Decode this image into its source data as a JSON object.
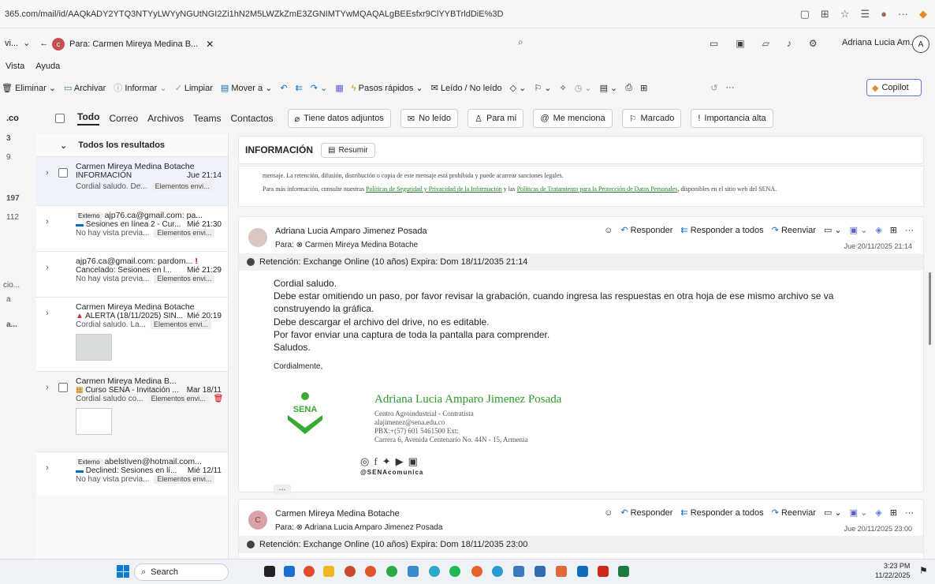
{
  "browser": {
    "url": "365.com/mail/id/AAQkADY2YTQ3NTYyLWYyNGUtNGI2Zi1hN2M5LWZkZmE3ZGNIMTYwMQAQALgBEEsfxr9ClYYBTrldDiE%3D"
  },
  "titlebar": {
    "tab_label": "Para: Carmen Mireya Medina B...",
    "tab_avatar": "c",
    "view_label": "vi...",
    "account_name": "Adriana Lucia Am...",
    "account_initial": "A"
  },
  "menu": {
    "items": [
      "Vista",
      "Ayuda"
    ]
  },
  "ribbon": {
    "eliminar": "Eliminar",
    "archivar": "Archivar",
    "informar": "Informar",
    "limpiar": "Limpiar",
    "mover": "Mover a",
    "pasos": "Pasos rápidos",
    "leido": "Leído / No leído",
    "copilot": "Copilot"
  },
  "filters": {
    "tabs": [
      "Todo",
      "Correo",
      "Archivos",
      "Teams",
      "Contactos"
    ],
    "chips": [
      "Tiene datos adjuntos",
      "No leído",
      "Para mí",
      "Me menciona",
      "Marcado",
      "Importancia alta"
    ]
  },
  "leftnav": {
    "top": ".co",
    "items": [
      "3",
      "9",
      "197",
      "112",
      "cio...",
      "a",
      "a..."
    ]
  },
  "list": {
    "header": "Todos los resultados",
    "items": [
      {
        "from": "Carmen Mireya Medina Botache",
        "subject": "INFORMACIÓN",
        "date": "Jue 21:14",
        "preview": "Cordial saludo. De...",
        "tag": "Elementos envi..."
      },
      {
        "ext": "Externo",
        "from": "ajp76.ca@gmail.com: pa...",
        "subject": "Sesiones en línea 2 - Cur...",
        "date": "Mié 21:30",
        "preview": "No hay vista previa...",
        "tag": "Elementos envi..."
      },
      {
        "from": "ajp76.ca@gmail.com: pardom...",
        "subject": "Cancelado: Sesiones en l...",
        "date": "Mié 21:29",
        "preview": "No hay vista previa...",
        "tag": "Elementos envi..."
      },
      {
        "from": "Carmen Mireya Medina Botache",
        "subject": "ALERTA (18/11/2025) SIN...",
        "date": "Mié 20:19",
        "preview": "Cordial saludo. La...",
        "tag": "Elementos envi..."
      },
      {
        "from": "Carmen Mireya Medina B...",
        "subject": "Curso SENA - Invitación ...",
        "date": "Mar 18/11",
        "preview": "Cordial saludo co...",
        "tag": "Elementos envi..."
      },
      {
        "ext": "Externo",
        "from": "abelstiven@hotmail.com...",
        "subject": "Declined: Sesiones en lí...",
        "date": "Mié 12/11",
        "preview": "No hay vista previa...",
        "tag": "Elementos envi..."
      }
    ]
  },
  "reading": {
    "title": "INFORMACIÓN",
    "resumir": "Resumir",
    "prev_line1": "mensaje. La retención, difusión, distribución o copia de este mensaje está prohibida y puede acarrear sanciones legales.",
    "prev_line2a": "Para más información, consulte nuestras",
    "prev_link1": "Políticas de Seguridad y Privacidad de la Información",
    "prev_line2b": "y las",
    "prev_link2": "Políticas de Tratamiento para la Protección de Datos Personales",
    "prev_line2c": ", disponibles en el sitio web del SENA.",
    "actions": {
      "responder": "Responder",
      "responder_todos": "Responder a todos",
      "reenviar": "Reenviar"
    },
    "messages": [
      {
        "from": "Adriana Lucia Amparo Jimenez Posada",
        "to": "Para: ⊗ Carmen Mireya Medina Botache",
        "date": "Jue 20/11/2025 21:14",
        "retention": "Retención: Exchange Online (10 años) Expira: Dom 18/11/2035 21:14",
        "body": [
          "Cordial saludo.",
          "Debe estar omitiendo un paso, por favor revisar la grabación, cuando ingresa las respuestas en otra hoja de ese mismo archivo se va construyendo la gráfica.",
          "Debe descargar el archivo del drive, no es editable.",
          "Por favor enviar una captura de toda la pantalla para comprender.",
          "Saludos."
        ],
        "closing": "Cordialmente,",
        "signature": {
          "name": "Adriana Lucia Amparo Jimenez Posada",
          "lines": [
            "Centro Agroindustrial - Contratista",
            "alajimenez@sena.edu.co",
            "PBX:+(57) 601 5461500 Ext:",
            "Carrera 6, Avenida Centenario No. 44N - 15, Armenia"
          ],
          "logo_text": "SENA",
          "handle": "@SENAcomunica"
        }
      },
      {
        "from": "Carmen Mireya Medina Botache",
        "to": "Para: ⊗ Adriana Lucia Amparo Jimenez Posada",
        "date": "Jue 20/11/2025 23:00",
        "avatar": "C",
        "retention": "Retención: Exchange Online (10 años) Expira: Dom 18/11/2035 23:00"
      }
    ]
  },
  "taskbar": {
    "search": "Search",
    "time": "3:23 PM",
    "date": "11/22/2025"
  },
  "colors": {
    "accent": "#0f6cbd",
    "sena_green": "#39a935"
  }
}
